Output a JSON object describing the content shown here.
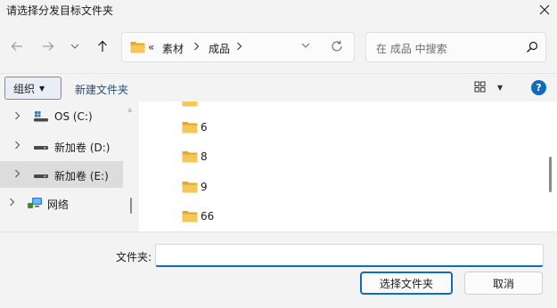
{
  "window": {
    "title": "请选择分发目标文件夹"
  },
  "nav": {
    "back": "back-arrow",
    "forward": "forward-arrow",
    "recent": "chevron-down",
    "up": "up-arrow"
  },
  "address": {
    "overflow": "«",
    "segments": [
      "素材",
      "成品"
    ],
    "separator": "›"
  },
  "search": {
    "placeholder": "在 成品 中搜索"
  },
  "toolbar": {
    "organize": "组织",
    "new_folder": "新建文件夹"
  },
  "sidebar": {
    "items": [
      {
        "label": "OS (C:)",
        "icon": "windows-drive"
      },
      {
        "label": "新加卷 (D:)",
        "icon": "drive"
      },
      {
        "label": "新加卷 (E:)",
        "icon": "drive",
        "selected": true
      },
      {
        "label": "网络",
        "icon": "network"
      }
    ]
  },
  "files": {
    "items": [
      {
        "name": "6"
      },
      {
        "name": "8"
      },
      {
        "name": "9"
      },
      {
        "name": "66"
      }
    ]
  },
  "footer": {
    "folder_label": "文件夹:",
    "folder_value": "",
    "select_button": "选择文件夹",
    "cancel_button": "取消"
  },
  "colors": {
    "accent": "#0f6cbd",
    "folder": "#f2c14e",
    "folder_dark": "#e3a82a",
    "selected_row": "#dcdcdc"
  }
}
